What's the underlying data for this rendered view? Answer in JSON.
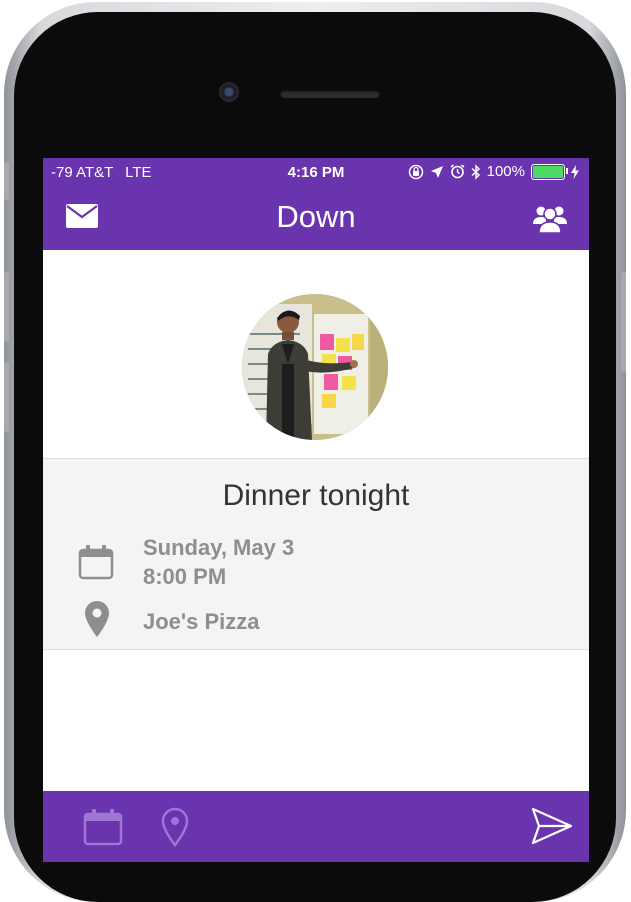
{
  "status_bar": {
    "carrier": "-79 AT&T",
    "network": "LTE",
    "time": "4:16 PM",
    "battery": "100%",
    "battery_level": 1.0,
    "icons": [
      "rotation-lock-icon",
      "location-arrow-icon",
      "alarm-icon",
      "bluetooth-icon",
      "battery-icon",
      "charging-icon"
    ]
  },
  "nav": {
    "title": "Down",
    "left_icon": "mail-icon",
    "right_icon": "friends-icon"
  },
  "event": {
    "title": "Dinner tonight",
    "date": "Sunday, May 3",
    "time": "8:00 PM",
    "place": "Joe's Pizza"
  },
  "bottom_bar": {
    "icons": [
      "calendar-icon",
      "location-pin-icon",
      "send-icon"
    ]
  },
  "colors": {
    "brand": "#6a34ae",
    "card_bg": "#f4f4f4",
    "secondary_text": "#8e8e8e"
  }
}
